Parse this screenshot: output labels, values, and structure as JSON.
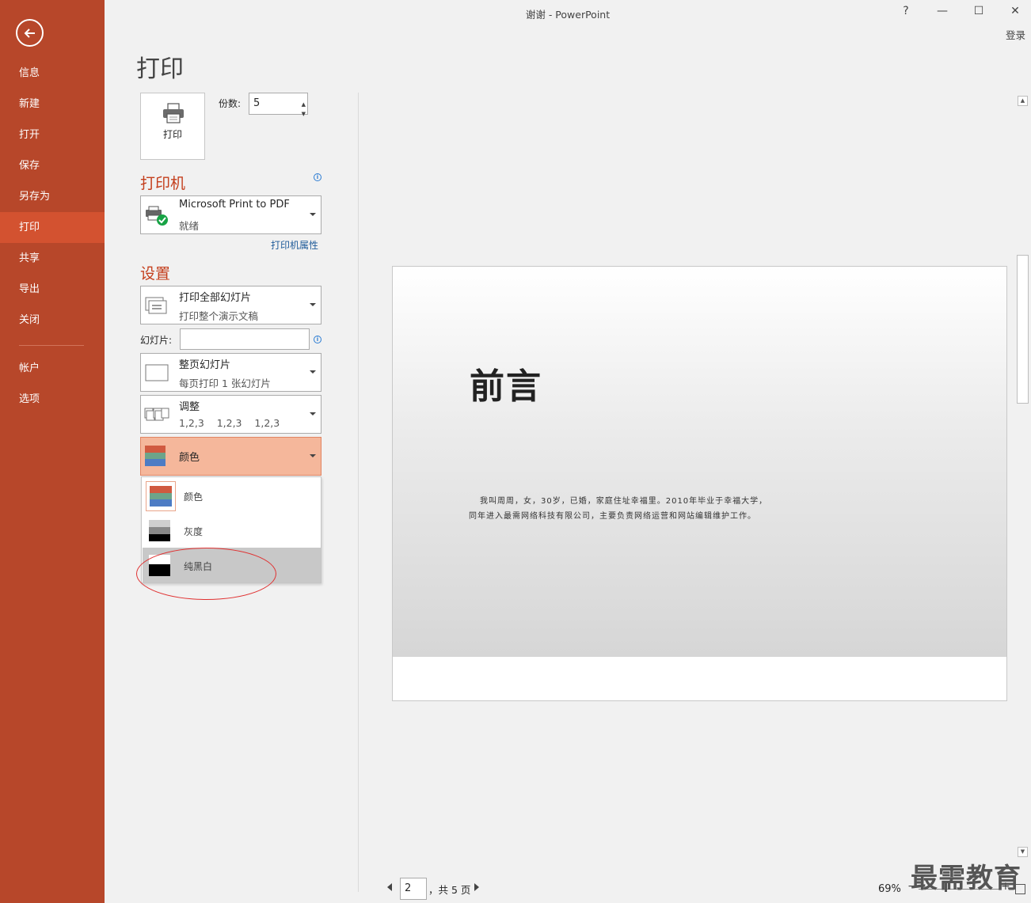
{
  "app": {
    "window_title": "谢谢 - PowerPoint",
    "help": "?",
    "minimize": "—",
    "maximize": "☐",
    "close": "✕",
    "login": "登录"
  },
  "sidebar": {
    "items": [
      {
        "label": "信息"
      },
      {
        "label": "新建"
      },
      {
        "label": "打开"
      },
      {
        "label": "保存"
      },
      {
        "label": "另存为"
      },
      {
        "label": "打印"
      },
      {
        "label": "共享"
      },
      {
        "label": "导出"
      },
      {
        "label": "关闭"
      },
      {
        "label": "帐户"
      },
      {
        "label": "选项"
      }
    ],
    "active": "打印",
    "colors": {
      "bg": "#b7472a",
      "active": "#d35230"
    }
  },
  "print": {
    "page_title": "打印",
    "print_button": "打印",
    "copies_label": "份数:",
    "copies_value": "5"
  },
  "printer": {
    "heading": "打印机",
    "name": "Microsoft Print to PDF",
    "status": "就绪",
    "properties_link": "打印机属性"
  },
  "settings": {
    "heading": "设置",
    "range": {
      "title": "打印全部幻灯片",
      "subtitle": "打印整个演示文稿"
    },
    "slides_label": "幻灯片:",
    "slides_value": "",
    "layout": {
      "title": "整页幻灯片",
      "subtitle": "每页打印 1 张幻灯片"
    },
    "collate": {
      "title": "调整",
      "subtitle": "1,2,3    1,2,3    1,2,3"
    },
    "color": {
      "title": "颜色"
    },
    "color_options": [
      {
        "label": "颜色"
      },
      {
        "label": "灰度"
      },
      {
        "label": "纯黑白"
      }
    ],
    "selected_color_option": "纯黑白"
  },
  "preview": {
    "slide_title": "前言",
    "slide_body_line1": "我叫周周，女，30岁，已婚，家庭住址幸福里。2010年毕业于幸福大学，",
    "slide_body_line2": "同年进入最需网络科技有限公司，主要负责网络运营和网站编辑维护工作。"
  },
  "footer": {
    "page_value": "2",
    "page_of": "，共 5 页",
    "zoom": "69%",
    "zoom_minus": "−",
    "zoom_plus": "+",
    "zoom_level": 0.5,
    "watermark": "最需教育"
  }
}
